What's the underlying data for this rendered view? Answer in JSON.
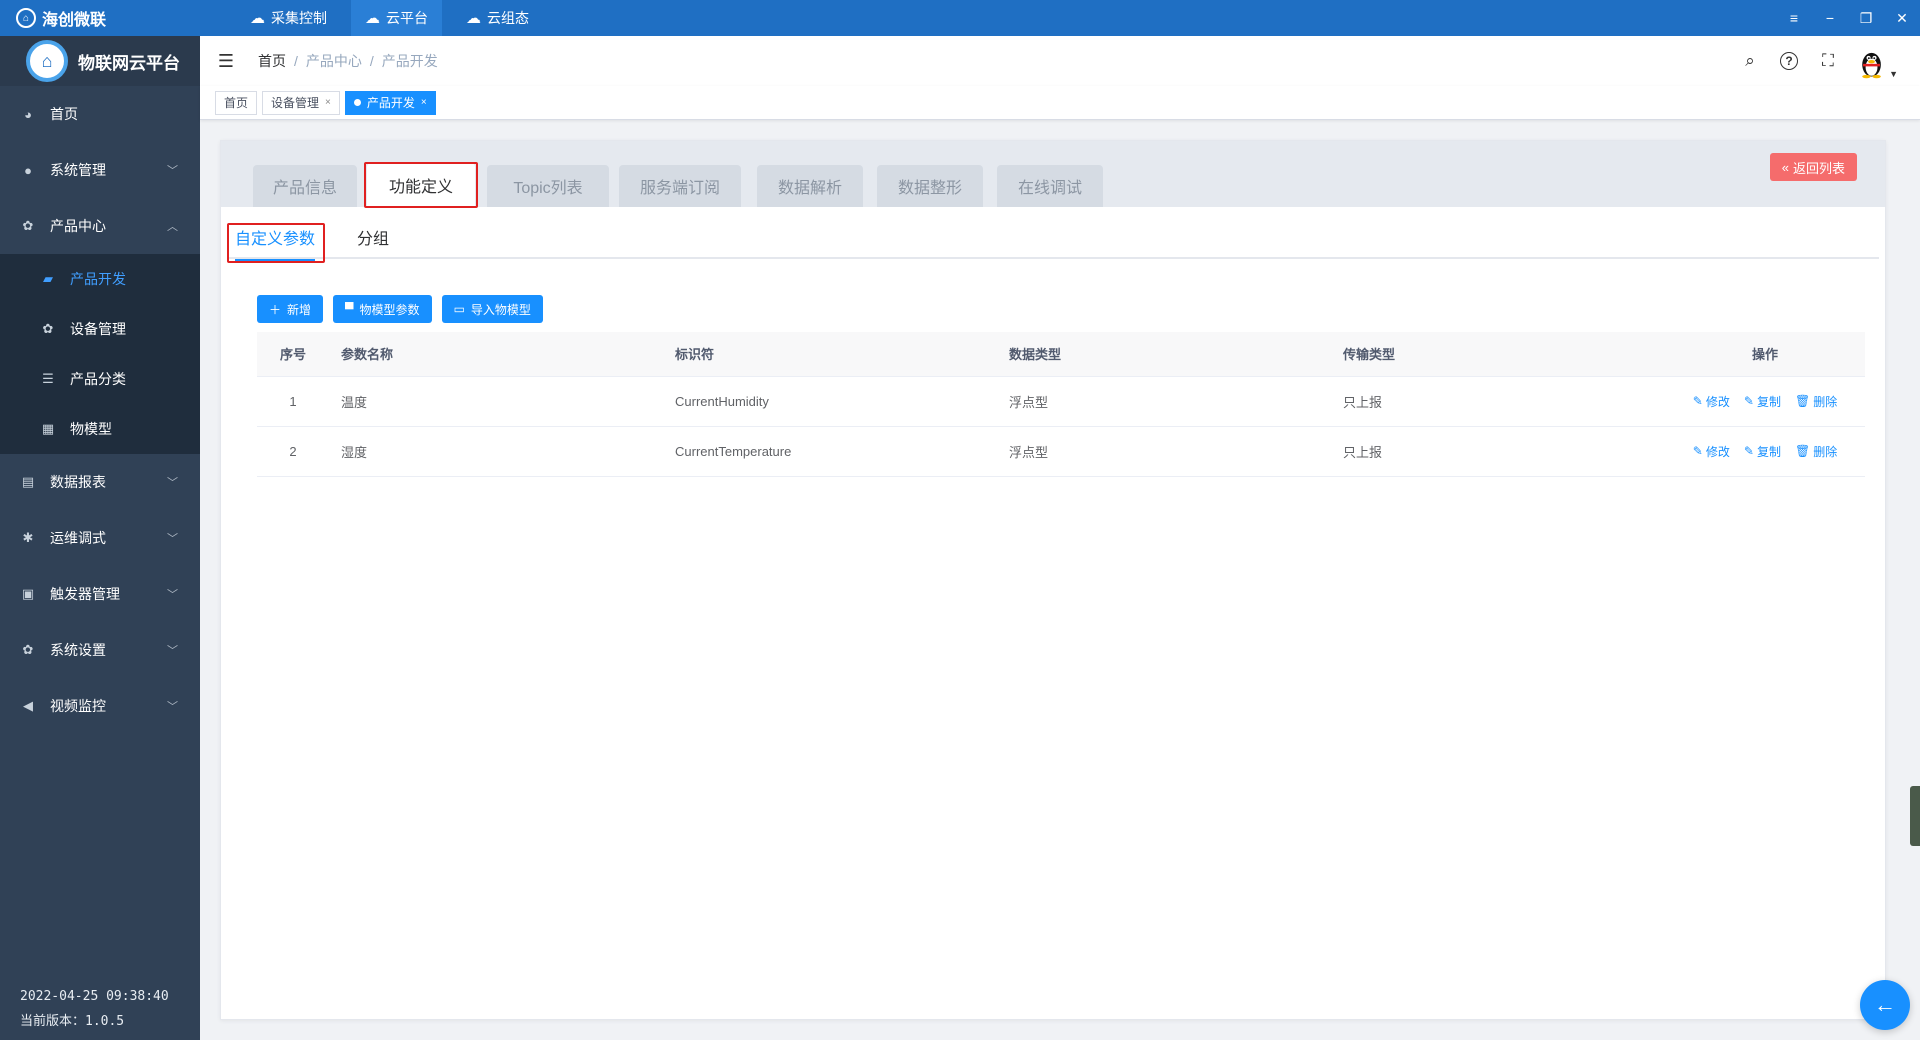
{
  "app": {
    "brand": "海创微联",
    "top_nav": [
      {
        "label": "采集控制",
        "icon": "cloud-icon"
      },
      {
        "label": "云平台",
        "icon": "cloud-icon"
      },
      {
        "label": "云组态",
        "icon": "cloud-icon"
      }
    ],
    "window_controls": [
      "menu-icon",
      "minimize-icon",
      "restore-icon",
      "close-icon"
    ]
  },
  "sidebar": {
    "title": "物联网云平台",
    "items": [
      {
        "label": "首页",
        "icon": "dashboard-icon"
      },
      {
        "label": "系统管理",
        "icon": "user-icon"
      },
      {
        "label": "产品中心",
        "icon": "gear-icon",
        "expanded": true
      },
      {
        "label": "数据报表",
        "icon": "report-icon"
      },
      {
        "label": "运维调式",
        "icon": "bug-icon"
      },
      {
        "label": "触发器管理",
        "icon": "trigger-icon"
      },
      {
        "label": "系统设置",
        "icon": "settings-icon"
      },
      {
        "label": "视频监控",
        "icon": "camera-icon"
      }
    ],
    "sub_items": [
      {
        "label": "产品开发",
        "icon": "folder-icon",
        "active": true
      },
      {
        "label": "设备管理",
        "icon": "gear-icon"
      },
      {
        "label": "产品分类",
        "icon": "list-icon"
      },
      {
        "label": "物模型",
        "icon": "grid-icon"
      }
    ],
    "footer_time": "2022-04-25 09:38:40",
    "footer_version": "当前版本：1.0.5"
  },
  "header": {
    "breadcrumb": [
      "首页",
      "产品中心",
      "产品开发"
    ],
    "separator": "/"
  },
  "tags_view": [
    {
      "label": "首页",
      "closable": false
    },
    {
      "label": "设备管理",
      "closable": true
    },
    {
      "label": "产品开发",
      "closable": true,
      "active": true
    }
  ],
  "product_tabs": [
    "产品信息",
    "功能定义",
    "Topic列表",
    "服务端订阅",
    "数据解析",
    "数据整形",
    "在线调试"
  ],
  "active_product_tab": "功能定义",
  "back_button": "返回列表",
  "sub_tabs": [
    "自定义参数",
    "分组"
  ],
  "toolbar": {
    "add": "新增",
    "model_params": "物模型参数",
    "import_model": "导入物模型"
  },
  "table": {
    "columns": [
      "序号",
      "参数名称",
      "标识符",
      "数据类型",
      "传输类型",
      "操作"
    ],
    "rows": [
      {
        "index": "1",
        "name": "温度",
        "identifier": "CurrentHumidity",
        "data_type": "浮点型",
        "transfer": "只上报"
      },
      {
        "index": "2",
        "name": "湿度",
        "identifier": "CurrentTemperature",
        "data_type": "浮点型",
        "transfer": "只上报"
      }
    ],
    "actions": {
      "edit": "修改",
      "copy": "复制",
      "delete": "删除"
    }
  },
  "colors": {
    "primary": "#1890ff",
    "topbar": "#1f6fc3",
    "sidebar": "#304156",
    "danger": "#f56c6c",
    "highlight_box": "#e02020"
  }
}
